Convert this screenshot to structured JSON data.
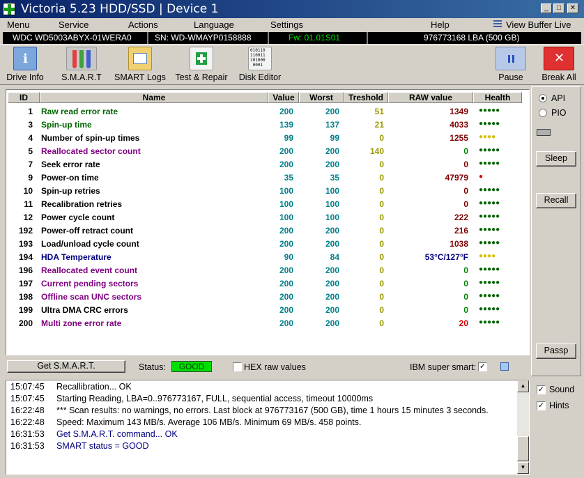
{
  "window": {
    "title": "Victoria 5.23 HDD/SSD | Device 1",
    "minimize": "_",
    "maximize": "□",
    "close": "✕"
  },
  "menu": {
    "items": [
      "Menu",
      "Service",
      "Actions",
      "Language",
      "Settings",
      "Help"
    ],
    "view_buffer": "View Buffer Live"
  },
  "device": {
    "model": "WDC WD5003ABYX-01WERA0",
    "serial": "SN: WD-WMAYP0158888",
    "firmware": "Fw: 01.01S01",
    "capacity": "976773168 LBA (500 GB)"
  },
  "toolbar": {
    "drive_info": "Drive Info",
    "smart": "S.M.A.R.T",
    "smart_logs": "SMART Logs",
    "test_repair": "Test & Repair",
    "disk_editor": "Disk Editor",
    "disk_editor_icon_text": "010110\n110011\n101000\n0001",
    "pause": "Pause",
    "break_all": "Break All"
  },
  "smart_table": {
    "headers": {
      "id": "ID",
      "name": "Name",
      "value": "Value",
      "worst": "Worst",
      "threshold": "Treshold",
      "raw": "RAW value",
      "health": "Health"
    },
    "rows": [
      {
        "id": "1",
        "name": "Raw read error rate",
        "value": "200",
        "worst": "200",
        "threshold": "51",
        "raw": "1349",
        "health": "●●●●●",
        "name_color": "#006400",
        "raw_color": "#800000",
        "health_color": "#006400"
      },
      {
        "id": "3",
        "name": "Spin-up time",
        "value": "139",
        "worst": "137",
        "threshold": "21",
        "raw": "4033",
        "health": "●●●●●",
        "name_color": "#006400",
        "raw_color": "#800000",
        "health_color": "#006400"
      },
      {
        "id": "4",
        "name": "Number of spin-up times",
        "value": "99",
        "worst": "99",
        "threshold": "0",
        "raw": "1255",
        "health": "●●●●",
        "name_color": "#000000",
        "raw_color": "#800000",
        "health_color": "#d4c000"
      },
      {
        "id": "5",
        "name": "Reallocated sector count",
        "value": "200",
        "worst": "200",
        "threshold": "140",
        "raw": "0",
        "health": "●●●●●",
        "name_color": "#800080",
        "raw_color": "#008000",
        "health_color": "#006400"
      },
      {
        "id": "7",
        "name": "Seek error rate",
        "value": "200",
        "worst": "200",
        "threshold": "0",
        "raw": "0",
        "health": "●●●●●",
        "name_color": "#000000",
        "raw_color": "#800000",
        "health_color": "#006400"
      },
      {
        "id": "9",
        "name": "Power-on time",
        "value": "35",
        "worst": "35",
        "threshold": "0",
        "raw": "47979",
        "health": "●",
        "name_color": "#000000",
        "raw_color": "#800000",
        "health_color": "#d00000"
      },
      {
        "id": "10",
        "name": "Spin-up retries",
        "value": "100",
        "worst": "100",
        "threshold": "0",
        "raw": "0",
        "health": "●●●●●",
        "name_color": "#000000",
        "raw_color": "#800000",
        "health_color": "#006400"
      },
      {
        "id": "11",
        "name": "Recalibration retries",
        "value": "100",
        "worst": "100",
        "threshold": "0",
        "raw": "0",
        "health": "●●●●●",
        "name_color": "#000000",
        "raw_color": "#800000",
        "health_color": "#006400"
      },
      {
        "id": "12",
        "name": "Power cycle count",
        "value": "100",
        "worst": "100",
        "threshold": "0",
        "raw": "222",
        "health": "●●●●●",
        "name_color": "#000000",
        "raw_color": "#800000",
        "health_color": "#006400"
      },
      {
        "id": "192",
        "name": "Power-off retract count",
        "value": "200",
        "worst": "200",
        "threshold": "0",
        "raw": "216",
        "health": "●●●●●",
        "name_color": "#000000",
        "raw_color": "#800000",
        "health_color": "#006400"
      },
      {
        "id": "193",
        "name": "Load/unload cycle count",
        "value": "200",
        "worst": "200",
        "threshold": "0",
        "raw": "1038",
        "health": "●●●●●",
        "name_color": "#000000",
        "raw_color": "#800000",
        "health_color": "#006400"
      },
      {
        "id": "194",
        "name": "HDA Temperature",
        "value": "90",
        "worst": "84",
        "threshold": "0",
        "raw": "53°C/127°F",
        "health": "●●●●",
        "name_color": "#000080",
        "raw_color": "#000080",
        "health_color": "#d4c000"
      },
      {
        "id": "196",
        "name": "Reallocated event count",
        "value": "200",
        "worst": "200",
        "threshold": "0",
        "raw": "0",
        "health": "●●●●●",
        "name_color": "#800080",
        "raw_color": "#008000",
        "health_color": "#006400"
      },
      {
        "id": "197",
        "name": "Current pending sectors",
        "value": "200",
        "worst": "200",
        "threshold": "0",
        "raw": "0",
        "health": "●●●●●",
        "name_color": "#800080",
        "raw_color": "#008000",
        "health_color": "#006400"
      },
      {
        "id": "198",
        "name": "Offline scan UNC sectors",
        "value": "200",
        "worst": "200",
        "threshold": "0",
        "raw": "0",
        "health": "●●●●●",
        "name_color": "#800080",
        "raw_color": "#008000",
        "health_color": "#006400"
      },
      {
        "id": "199",
        "name": "Ultra DMA CRC errors",
        "value": "200",
        "worst": "200",
        "threshold": "0",
        "raw": "0",
        "health": "●●●●●",
        "name_color": "#000000",
        "raw_color": "#008000",
        "health_color": "#006400"
      },
      {
        "id": "200",
        "name": "Multi zone error rate",
        "value": "200",
        "worst": "200",
        "threshold": "0",
        "raw": "20",
        "health": "●●●●●",
        "name_color": "#800080",
        "raw_color": "#d00000",
        "health_color": "#006400"
      }
    ]
  },
  "smart_bar": {
    "get_smart": "Get S.M.A.R.T.",
    "status_label": "Status:",
    "status_value": "GOOD",
    "hex_raw": "HEX raw values",
    "ibm_super_smart": "IBM super smart:"
  },
  "right_panel": {
    "api": "API",
    "pio": "PIO",
    "sleep": "Sleep",
    "recall": "Recall",
    "passp": "Passp"
  },
  "log": [
    {
      "time": "15:07:45",
      "msg": "Recallibration... OK",
      "color": "#000000"
    },
    {
      "time": "15:07:45",
      "msg": "Starting Reading, LBA=0..976773167, FULL, sequential access, timeout 10000ms",
      "color": "#000000"
    },
    {
      "time": "16:22:48",
      "msg": "*** Scan results: no warnings, no errors. Last block at 976773167 (500 GB), time 1 hours 15 minutes 3 seconds.",
      "color": "#000000"
    },
    {
      "time": "16:22:48",
      "msg": "Speed: Maximum 143 MB/s. Average 106 MB/s. Minimum 69 MB/s. 458 points.",
      "color": "#000000"
    },
    {
      "time": "16:31:53",
      "msg": "Get S.M.A.R.T. command... OK",
      "color": "#000080"
    },
    {
      "time": "16:31:53",
      "msg": "SMART status = GOOD",
      "color": "#000080"
    }
  ],
  "bottom_right": {
    "sound": "Sound",
    "hints": "Hints"
  },
  "colors": {
    "status_good": "#00e000",
    "title_start": "#0a246a",
    "title_end": "#3a6ea5"
  }
}
